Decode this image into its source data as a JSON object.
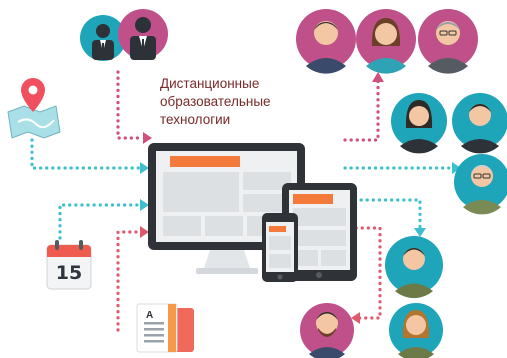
{
  "caption": {
    "line1": "Дистанционные",
    "line2": "образовательные",
    "line3": "технологии"
  },
  "calendar": {
    "day": "15"
  },
  "book": {
    "label": "A"
  },
  "colors": {
    "pink": "#c0508a",
    "teal": "#1fa5b9",
    "red_dots": "#e05a6e",
    "teal_dots": "#3dbfd0",
    "orange": "#f47a3b",
    "screen_gray": "#dfe1e3",
    "device_dark": "#2f3338"
  },
  "icons": [
    "map-pin-icon",
    "calendar-icon",
    "book-icon",
    "user-group-icon",
    "avatar-icon",
    "monitor-icon",
    "tablet-icon",
    "phone-icon"
  ]
}
